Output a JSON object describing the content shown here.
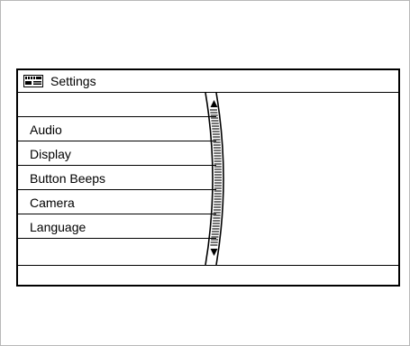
{
  "header": {
    "title": "Settings"
  },
  "menu": {
    "items": [
      {
        "label": ""
      },
      {
        "label": "Audio"
      },
      {
        "label": "Display"
      },
      {
        "label": "Button Beeps"
      },
      {
        "label": "Camera"
      },
      {
        "label": "Language"
      },
      {
        "label": ""
      }
    ]
  },
  "icons": {
    "title": "settings-screen-icon",
    "scroll_up": "triangle-up",
    "scroll_down": "triangle-down"
  },
  "colors": {
    "line": "#000000",
    "background": "#ffffff",
    "outer_frame": "#b8b8b8"
  }
}
